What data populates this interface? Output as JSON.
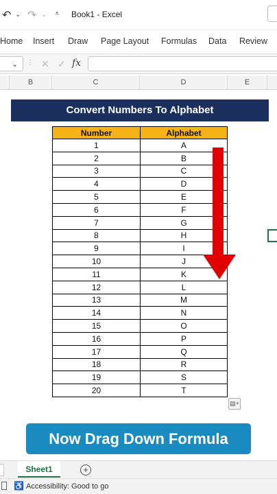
{
  "title_bar": {
    "document_title": "Book1 - Excel",
    "undo_icon": "↶",
    "redo_icon": "↷",
    "caret": "⌄",
    "qat_icon": "⩡"
  },
  "ribbon": {
    "tabs": [
      "Home",
      "Insert",
      "Draw",
      "Page Layout",
      "Formulas",
      "Data",
      "Review"
    ]
  },
  "formula_bar": {
    "namebox_caret": "⌄",
    "dots": "⋮",
    "cancel_icon": "✕",
    "enter_icon": "✓",
    "fx_label": "fx",
    "value": ""
  },
  "columns": [
    "B",
    "C",
    "D",
    "E"
  ],
  "sheet": {
    "banner_title": "Convert Numbers To Alphabet",
    "table": {
      "headers": [
        "Number",
        "Alphabet"
      ],
      "rows": [
        [
          "1",
          "A"
        ],
        [
          "2",
          "B"
        ],
        [
          "3",
          "C"
        ],
        [
          "4",
          "D"
        ],
        [
          "5",
          "E"
        ],
        [
          "6",
          "F"
        ],
        [
          "7",
          "G"
        ],
        [
          "8",
          "H"
        ],
        [
          "9",
          "I"
        ],
        [
          "10",
          "J"
        ],
        [
          "11",
          "K"
        ],
        [
          "12",
          "L"
        ],
        [
          "13",
          "M"
        ],
        [
          "14",
          "N"
        ],
        [
          "15",
          "O"
        ],
        [
          "16",
          "P"
        ],
        [
          "17",
          "Q"
        ],
        [
          "18",
          "R"
        ],
        [
          "19",
          "S"
        ],
        [
          "20",
          "T"
        ]
      ]
    },
    "caption": "Now Drag Down Formula",
    "arrow_color": "#e00000",
    "paste_options_icon": "▤+"
  },
  "sheet_tabs": {
    "active": "Sheet1",
    "add_icon": "+"
  },
  "status_bar": {
    "accessibility_icon": "♿",
    "accessibility_text": "Accessibility: Good to go"
  },
  "colors": {
    "banner_bg": "#1b2f5e",
    "header_bg": "#f7b217",
    "caption_bg": "#1a8bc1",
    "excel_green": "#1e7145"
  }
}
